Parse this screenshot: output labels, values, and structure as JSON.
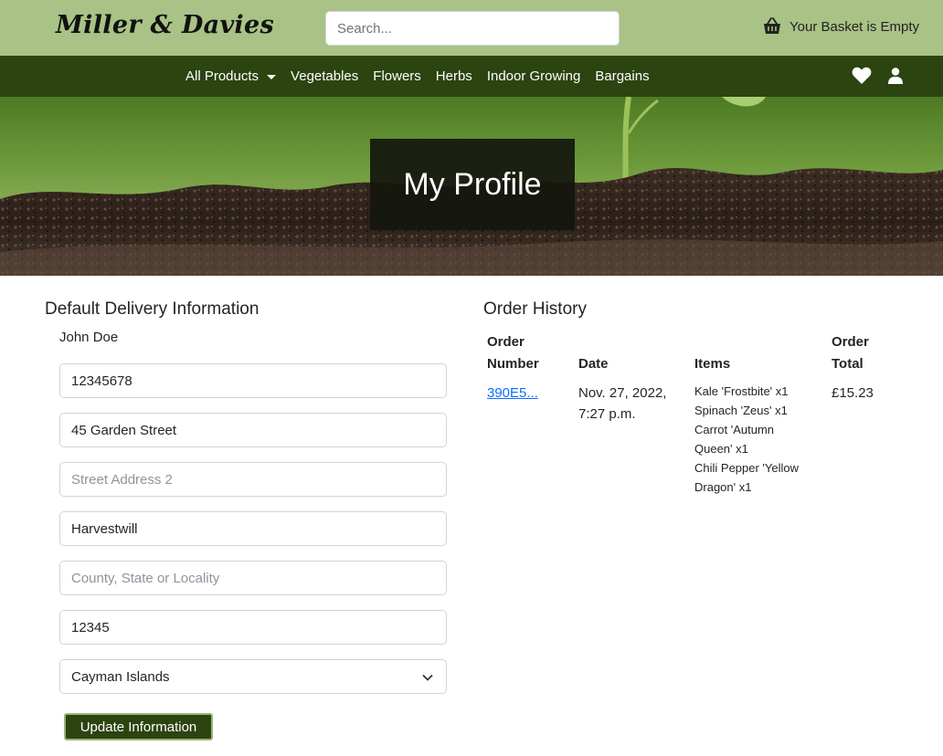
{
  "header": {
    "logo": "Miller & Davies",
    "search_placeholder": "Search...",
    "basket_text": "Your Basket is Empty"
  },
  "nav": {
    "items": [
      {
        "label": "All Products",
        "dropdown": true
      },
      {
        "label": "Vegetables"
      },
      {
        "label": "Flowers"
      },
      {
        "label": "Herbs"
      },
      {
        "label": "Indoor Growing"
      },
      {
        "label": "Bargains"
      }
    ],
    "icons": [
      "heart-icon",
      "user-icon"
    ]
  },
  "hero": {
    "title": "My Profile"
  },
  "delivery": {
    "heading": "Default Delivery Information",
    "name": "John Doe",
    "phone": "12345678",
    "street1": "45 Garden Street",
    "street2_placeholder": "Street Address 2",
    "town": "Harvestwill",
    "county_placeholder": "County, State or Locality",
    "postcode": "12345",
    "country": "Cayman Islands",
    "update_label": "Update Information"
  },
  "orders": {
    "heading": "Order History",
    "columns": {
      "number_line1": "Order",
      "number_line2": "Number",
      "date": "Date",
      "items": "Items",
      "total_line1": "Order",
      "total_line2": "Total"
    },
    "rows": [
      {
        "number": "390E5...",
        "date_line1": "Nov. 27, 2022,",
        "date_line2": "7:27 p.m.",
        "items": [
          "Kale 'Frostbite' x1",
          "Spinach 'Zeus' x1",
          "Carrot 'Autumn",
          "Queen' x1",
          "Chili Pepper 'Yellow",
          "Dragon' x1"
        ],
        "total": "£15.23"
      }
    ]
  },
  "colors": {
    "topbar": "#a9c285",
    "navbar": "#2c4410",
    "link": "#0d6efd"
  }
}
